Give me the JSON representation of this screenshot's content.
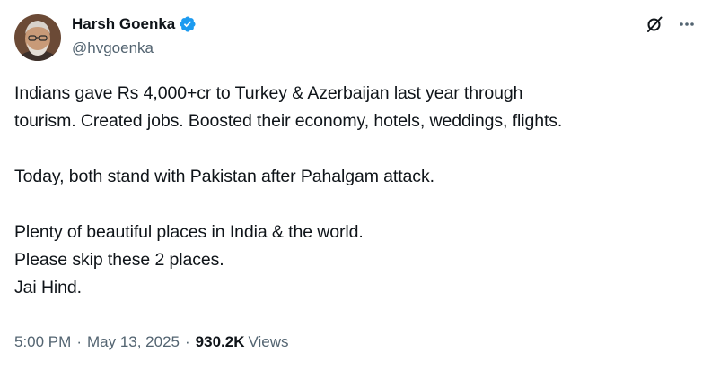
{
  "author": {
    "display_name": "Harsh Goenka",
    "handle": "@hvgoenka",
    "verified": true,
    "verified_color": "#1d9bf0"
  },
  "icons": {
    "verified": "verified-badge-icon",
    "grok": "grok-icon",
    "more": "more-icon"
  },
  "tweet": {
    "lines": [
      "Indians gave Rs 4,000+cr to Turkey & Azerbaijan last year through",
      "tourism. Created jobs. Boosted their economy, hotels, weddings, flights.",
      "",
      "Today, both stand with Pakistan after Pahalgam attack.",
      "",
      "Plenty of beautiful places in India & the world.",
      "Please skip these 2 places.",
      "Jai Hind."
    ]
  },
  "meta": {
    "time": "5:00 PM",
    "separator": "·",
    "date": "May 13, 2025",
    "views_count": "930.2K",
    "views_label": "Views"
  },
  "colors": {
    "text_primary": "#0f1419",
    "text_secondary": "#536471",
    "accent": "#1d9bf0"
  }
}
